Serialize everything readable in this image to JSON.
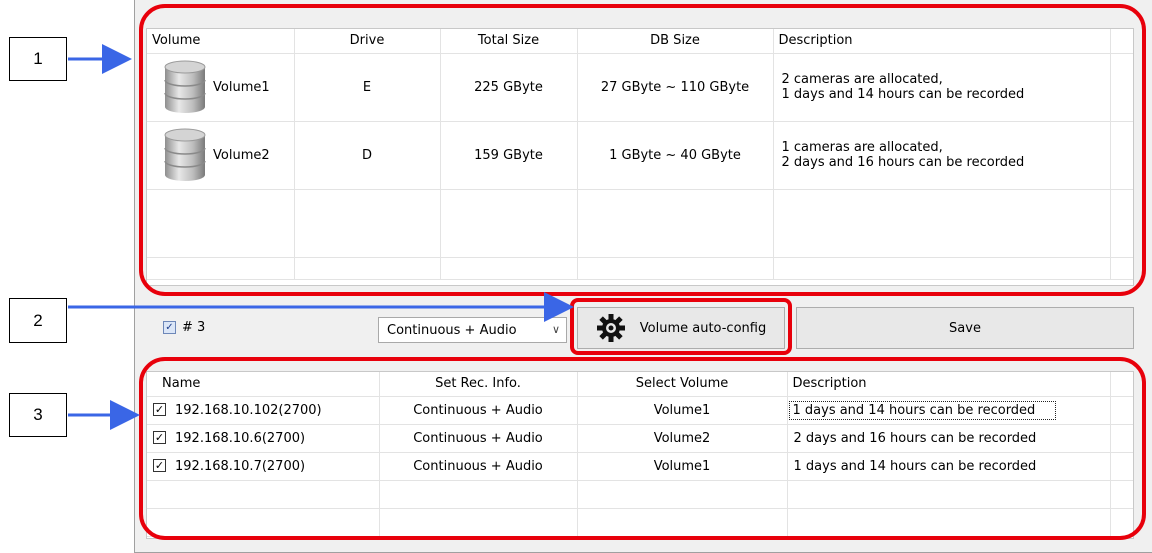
{
  "callout_labels": [
    "1",
    "2",
    "3"
  ],
  "accent_colors": {
    "callout": "#e8000b",
    "arrow": "#3a66e6"
  },
  "volume_table": {
    "headers": [
      "Volume",
      "Drive",
      "Total Size",
      "DB Size",
      "Description"
    ],
    "rows": [
      {
        "icon": "database-icon",
        "volume": "Volume1",
        "drive": "E",
        "total": "225 GByte",
        "db": "27 GByte ~ 110 GByte",
        "desc1": "2 cameras are allocated,",
        "desc2": "1 days and 14 hours can be recorded"
      },
      {
        "icon": "database-icon",
        "volume": "Volume2",
        "drive": "D",
        "total": "159 GByte",
        "db": "1 GByte ~ 40 GByte",
        "desc1": "1 cameras are allocated,",
        "desc2": "2 days and 16 hours can be recorded"
      }
    ]
  },
  "toolbar": {
    "channel_checked": true,
    "channel_label": "# 3",
    "mode_value": "Continuous + Audio",
    "auto_config_icon": "gear-icon",
    "auto_config_label": "Volume auto-config",
    "save_label": "Save"
  },
  "recording_table": {
    "headers": [
      "Name",
      "Set Rec. Info.",
      "Select Volume",
      "Description"
    ],
    "rows": [
      {
        "checked": true,
        "name": "192.168.10.102(2700)",
        "rec": "Continuous + Audio",
        "volume": "Volume1",
        "desc": "1 days and 14 hours can be recorded"
      },
      {
        "checked": true,
        "name": "192.168.10.6(2700)",
        "rec": "Continuous + Audio",
        "volume": "Volume2",
        "desc": "2 days and 16 hours can be recorded"
      },
      {
        "checked": true,
        "name": "192.168.10.7(2700)",
        "rec": "Continuous + Audio",
        "volume": "Volume1",
        "desc": "1 days and 14 hours can be recorded"
      }
    ]
  }
}
